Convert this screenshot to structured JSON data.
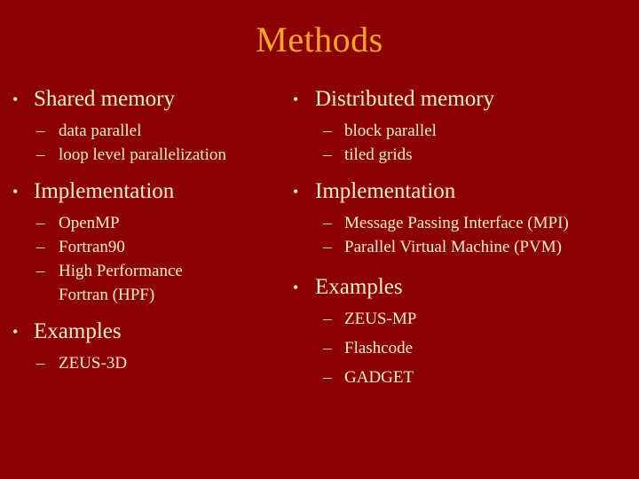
{
  "slide": {
    "title": "Methods",
    "background_color": "#8b0000",
    "title_color": "#f5a623",
    "body_color": "#faf0c8",
    "bullet_marker_level1": "•",
    "bullet_marker_level2": "–"
  },
  "left_column": {
    "sections": [
      {
        "heading": "Shared memory",
        "items": [
          "data parallel",
          "loop level parallelization"
        ]
      },
      {
        "heading": "Implementation",
        "items": [
          "OpenMP",
          "Fortran90",
          "High Performance Fortran (HPF)"
        ]
      },
      {
        "heading": "Examples",
        "items": [
          "ZEUS-3D"
        ]
      }
    ]
  },
  "right_column": {
    "sections": [
      {
        "heading": "Distributed memory",
        "items": [
          "block parallel",
          "tiled grids"
        ]
      },
      {
        "heading": "Implementation",
        "items": [
          "Message Passing Interface (MPI)",
          "Parallel Virtual Machine (PVM)"
        ]
      },
      {
        "heading": "Examples",
        "items": [
          "ZEUS-MP",
          "Flashcode",
          "GADGET"
        ]
      }
    ]
  }
}
